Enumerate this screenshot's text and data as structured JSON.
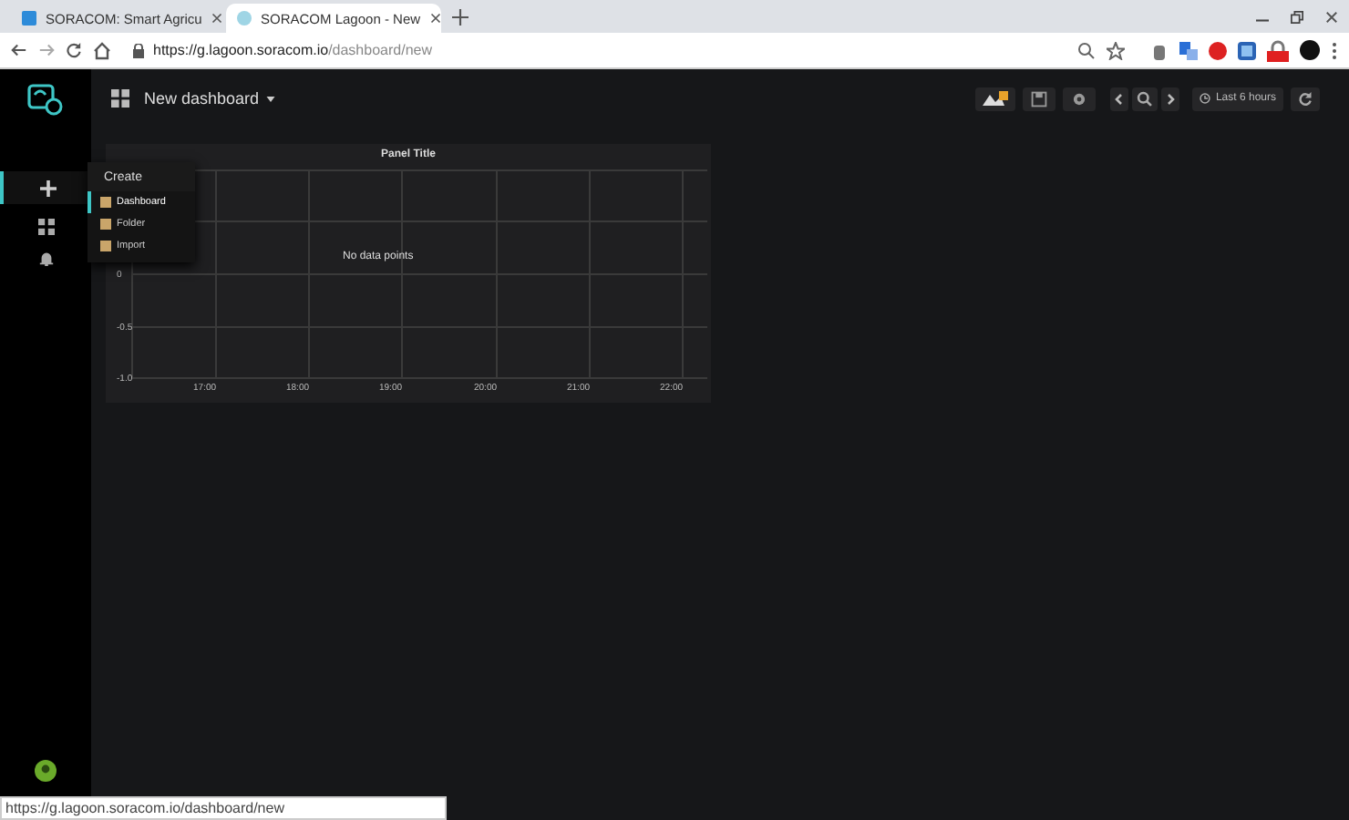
{
  "browser": {
    "tabs": [
      {
        "title": "SORACOM: Smart Agricu",
        "selected": false
      },
      {
        "title": "SORACOM Lagoon - New",
        "selected": true
      }
    ],
    "url_host": "https://g.lagoon.soracom.io",
    "url_path": "/dashboard/new"
  },
  "dashboard": {
    "title": "New dashboard",
    "time_range": "Last 6 hours"
  },
  "create_menu": {
    "title": "Create",
    "items": [
      {
        "label": "Dashboard",
        "selected": true
      },
      {
        "label": "Folder",
        "selected": false
      },
      {
        "label": "Import",
        "selected": false
      }
    ]
  },
  "panel": {
    "title": "Panel Title",
    "message": "No data points",
    "y_ticks": [
      "0",
      "-0.5",
      "-1.0"
    ],
    "x_ticks": [
      "17:00",
      "18:00",
      "19:00",
      "20:00",
      "21:00",
      "22:00"
    ]
  },
  "status_url": "https://g.lagoon.soracom.io/dashboard/new"
}
